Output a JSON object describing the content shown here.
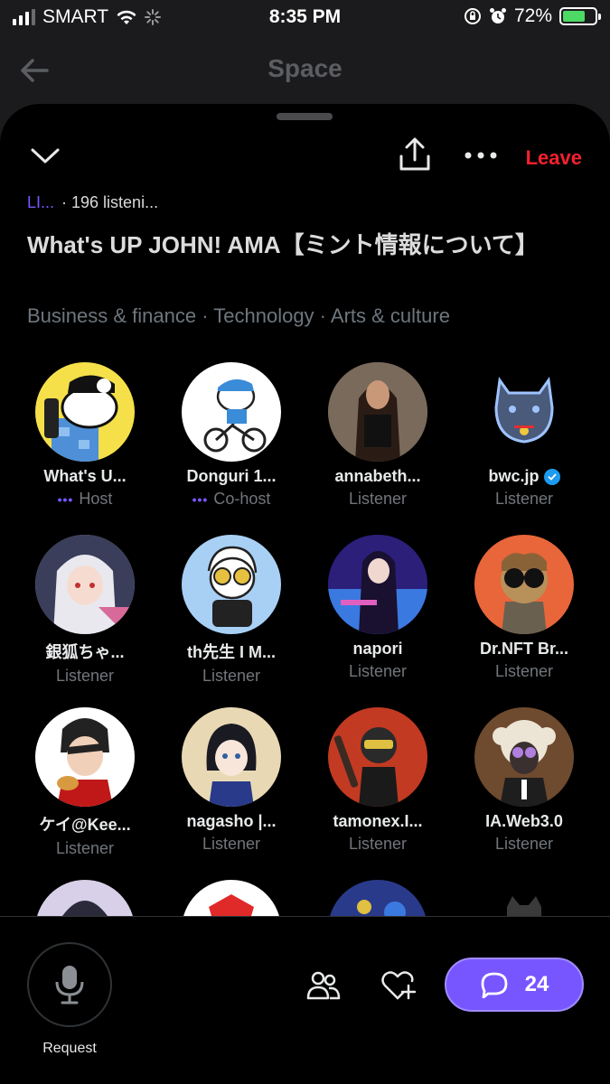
{
  "status_bar": {
    "carrier": "SMART",
    "time": "8:35 PM",
    "battery": "72%"
  },
  "header": {
    "title": "Space"
  },
  "space": {
    "leave_label": "Leave",
    "live_label": "LI...",
    "listeners": "· 196 listeni...",
    "title": "What's UP JOHN! AMA【ミント情報について】",
    "topics": "Business & finance · Technology · Arts & culture"
  },
  "participants": [
    {
      "name": "What's U...",
      "role": "Host",
      "role_dots": true,
      "color": "#f5e04a"
    },
    {
      "name": "Donguri 1...",
      "role": "Co-host",
      "role_dots": true,
      "color": "#ffffff"
    },
    {
      "name": "annabeth...",
      "role": "Listener",
      "color": "#6b5b4e"
    },
    {
      "name": "bwc.jp",
      "role": "Listener",
      "verified": true,
      "color": "#000000"
    },
    {
      "name": "銀狐ちゃ...",
      "role": "Listener",
      "color": "#c9b8d8"
    },
    {
      "name": "th先生 I M...",
      "role": "Listener",
      "color": "#a8d0f5"
    },
    {
      "name": "napori",
      "role": "Listener",
      "color": "#2a1a6e"
    },
    {
      "name": "Dr.NFT Br...",
      "role": "Listener",
      "color": "#e8663a"
    },
    {
      "name": "ケイ@Kee...",
      "role": "Listener",
      "color": "#ffffff"
    },
    {
      "name": "nagasho |...",
      "role": "Listener",
      "color": "#e8d9b4"
    },
    {
      "name": "tamonex.I...",
      "role": "Listener",
      "color": "#c23a22"
    },
    {
      "name": "IA.Web3.0",
      "role": "Listener",
      "color": "#6e4a2e"
    }
  ],
  "bottom": {
    "request_label": "Request",
    "chat_count": "24"
  },
  "colors": {
    "accent": "#7856ff",
    "leave": "#f4212e",
    "verified": "#1d9bf0"
  }
}
